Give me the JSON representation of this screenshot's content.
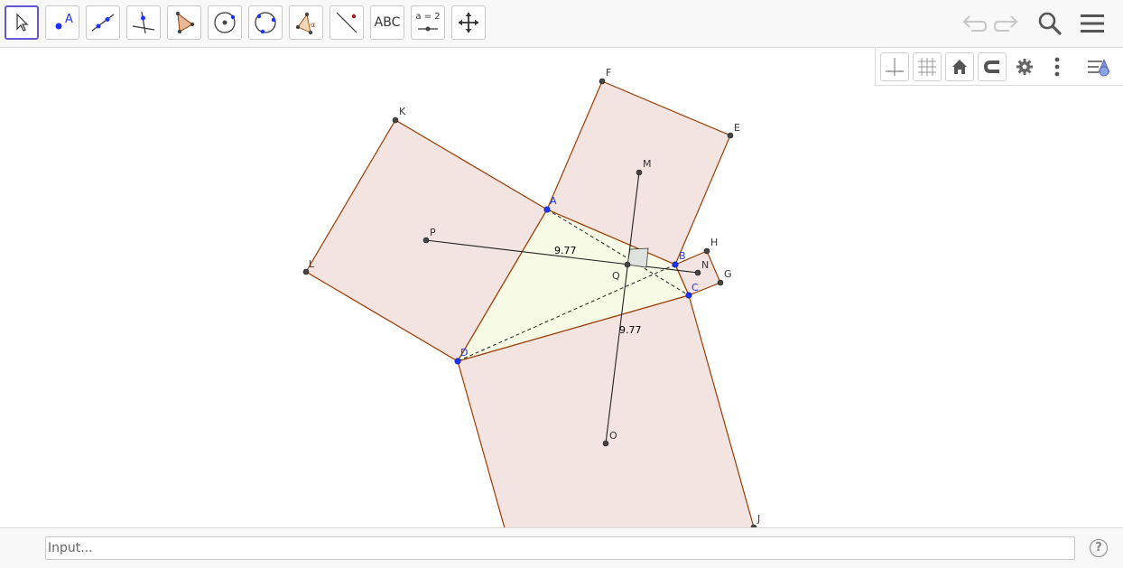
{
  "toolbar": {
    "tools": [
      {
        "name": "move-tool",
        "label": ""
      },
      {
        "name": "point-tool",
        "label": "A"
      },
      {
        "name": "line-tool",
        "label": ""
      },
      {
        "name": "perpendicular-line-tool",
        "label": ""
      },
      {
        "name": "polygon-tool",
        "label": ""
      },
      {
        "name": "circle-center-point-tool",
        "label": ""
      },
      {
        "name": "circle-three-points-tool",
        "label": ""
      },
      {
        "name": "angle-tool",
        "label": ""
      },
      {
        "name": "reflect-about-line-tool",
        "label": ""
      },
      {
        "name": "text-tool",
        "label": "ABC"
      },
      {
        "name": "slider-tool",
        "label": "a = 2"
      },
      {
        "name": "move-graphics-view-tool",
        "label": ""
      }
    ],
    "right_icons": [
      "undo-icon",
      "redo-icon",
      "search-icon",
      "menu-icon"
    ]
  },
  "style_bar": {
    "icons": [
      "axes-icon",
      "grid-icon",
      "home-icon",
      "magnet-icon",
      "gear-icon",
      "more-vertical-icon",
      "toggle-style-bar-icon"
    ]
  },
  "graphics": {
    "points": {
      "A": "A",
      "B": "B",
      "C": "C",
      "D": "D",
      "E": "E",
      "F": "F",
      "G": "G",
      "H": "H",
      "J": "J",
      "K": "K",
      "L": "L",
      "M": "M",
      "N": "N",
      "O": "O",
      "P": "P",
      "Q": "Q"
    },
    "measurements": {
      "pq_length": "9.77",
      "mo_length": "9.77"
    },
    "colors": {
      "square_fill": "#f3e4e1",
      "square_edge": "#9a3c00",
      "quad_fill": "#f7fbe6",
      "free_point": "#1e33ff",
      "dependent_point": "#444444"
    }
  },
  "input_bar": {
    "placeholder": "Input..."
  },
  "help_label": "?"
}
